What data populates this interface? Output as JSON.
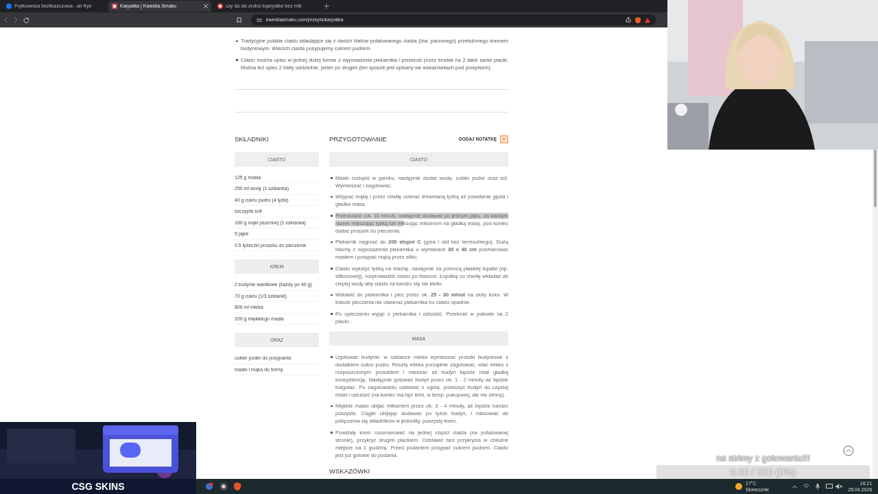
{
  "browser": {
    "tabs": [
      {
        "title": "Frytkownica beztłuszczowa - air frye",
        "selected": false,
        "kind": "social"
      },
      {
        "title": "Karpatka | Kwestia Smaku",
        "selected": true,
        "kind": "site"
      },
      {
        "title": "czy da sie zrobci kqarpatke bez mik",
        "selected": false,
        "kind": "search"
      }
    ],
    "url": "kwestiasmaku.com/przepis/karpatka"
  },
  "recipe": {
    "intro": [
      "Tradycyjne polskie ciasto składające się z dwóch blatów pofalowanego ciasta (tzw. parzonego) przełożonego kremem budyniowym. Wierzch ciasta posypujemy cukrem pudrem.",
      "Ciasto można upiec w jednej dużej formie z wyposażenia piekarnika i przekroić przez środek na 2 takie same placki. Można też upiec 2 blaty oddzielnie, jeden po drugim (ten sposób jest opisany we wskazówkach pod przepisem)."
    ],
    "ingredients_heading": "SKŁADNIKI",
    "preparation_heading": "PRZYGOTOWANIE",
    "add_note": "DODAJ NOTATKĘ",
    "ingredient_groups": [
      {
        "title": "CIASTO",
        "items": [
          "125 g masła",
          "250 ml wody (1 szklanka)",
          "40 g cukru pudru (4 łyżki)",
          "szczypta soli",
          "160 g mąki pszennej (1 szklanka)",
          "5 jajek",
          "0.5 łyżeczki proszku do pieczenia"
        ]
      },
      {
        "title": "KREM",
        "items": [
          "2 budynie waniliowe (każdy po 40 g)",
          "70 g cukru (1/3 szklanki)",
          "800 ml mleka",
          "200 g miękkiego masła"
        ]
      },
      {
        "title": "ORAZ",
        "items": [
          "cukier puder do posypania",
          "masło i mąka do formy"
        ]
      }
    ],
    "step_groups": [
      {
        "title": "CIASTO",
        "steps": [
          {
            "text": "Masło roztopić w garnku, następnie dodać wodę, cukier puder oraz sól. Wymieszać i zagotować."
          },
          {
            "text": "Wsypać mąkę i przez chwilę ucierać drewnianą łyżką aż powstanie gęsta i gładka masa."
          },
          {
            "selection": "Przestudzić (ok. 10 minut), następnie dodawać po jednym jajku, za każdym razem mieszając łyżką lub mi",
            "text": "ksując mikserem na gładką masę, pod koniec dodać proszek do pieczenia."
          },
          {
            "text": "Piekarnik nagrzać do **200 stopni C** (góra i dół bez termoobiegu). Dużą blachę z wyposażenia piekarnika o wymiarach **30 x 40 cm** posmarować masłem i posypać mąką przez sitko."
          },
          {
            "text": "Ciasto wyłożyć łyżką na blachę, następnie za pomocą płaskiej łopatki (np. silikonowej), rozprowadzić ciasto po blaszce. Łopatkę co chwilę wkładać do ciepłej wody aby ciasto za bardzo się nie kleiło."
          },
          {
            "text": "Wstawić do piekarnika i piec przez ok. **25 - 30 minut** na złoty kolor. W trakcie pieczenia nie otwierać piekarnika bo ciasto opadnie."
          },
          {
            "text": "Po upieczeniu wyjąć z piekarnika i ostudzić. Przekroić w połowie na 2 placki."
          }
        ]
      },
      {
        "title": "MASA",
        "steps": [
          {
            "text": "Ugotować budynie: w szklance mleka wymieszać proszki budyniowe z dodatkiem cukru pudru. Resztę mleka porządnie zagotować, wlać mleko z rozpuszczonym proszkiem i mieszać aż budyń będzie miał gładką konsystencję. Następnie gotować budyń przez ok. 1 - 2 minuty aż będzie bulgotać. Po zagotowaniu odstawić z ognia, przełożyć budyń do czystej miski i ostudzić (na koniec ma być letni, w temp. pokojowej, ale nie zimny)."
          },
          {
            "text": "Miękkie masło ubijać mikserem przez ok. 3 - 4 minuty, aż będzie bardzo puszyste. Ciągle ubijając dodawać po łyżce budyń, i miksować do połączenia się składników w jednolity, puszysty krem."
          },
          {
            "text": "Powstały krem rozsmarować na jednej części ciasta (na pofalowanej stronie), przykryć drugim plackiem. Odstawić bez przykrycia w chłodne miejsce na 1 godzinę. Przed podaniem posypać cukrem pudrem. Ciasto jest już gotowe do podania."
          }
        ]
      }
    ],
    "tips_heading": "WSKAZÓWKI"
  },
  "ad": {
    "kind": "picture",
    "banner": "CSG SKINS"
  },
  "donation_goal": {
    "title": "na strimy z gotowania!!!",
    "reading": "0.00 / 500 (0%)",
    "level": 0
  },
  "taskbar": {
    "weather_temp": "17°C",
    "weather_text": "Słonecznie",
    "time": "16:21",
    "date": "25.04.2026"
  }
}
